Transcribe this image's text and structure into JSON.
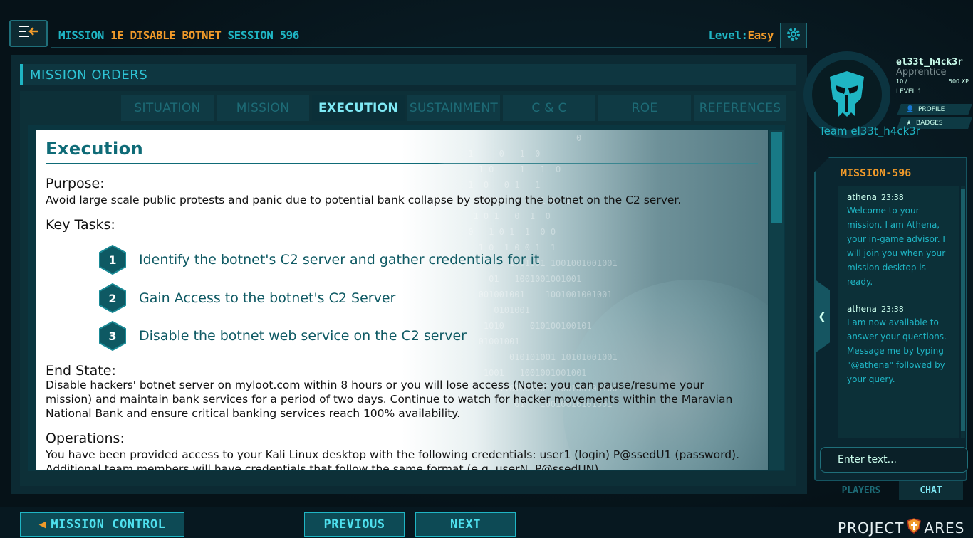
{
  "header": {
    "mission_prefix": "MISSION ",
    "mission_id": "1E DISABLE BOTNET",
    "session": " SESSION 596",
    "level_label": "Level:",
    "level_value": "Easy"
  },
  "orders": {
    "title": "MISSION ORDERS"
  },
  "tabs": [
    {
      "label": "SITUATION",
      "active": false
    },
    {
      "label": "MISSION",
      "active": false
    },
    {
      "label": "EXECUTION",
      "active": true
    },
    {
      "label": "SUSTAINMENT",
      "active": false
    },
    {
      "label": "C & C",
      "active": false
    },
    {
      "label": "ROE",
      "active": false
    },
    {
      "label": "REFERENCES",
      "active": false
    }
  ],
  "doc": {
    "title": "Execution",
    "purpose_heading": "Purpose:",
    "purpose_text": "Avoid large scale public protests and panic due to potential bank collapse by stopping the botnet on the C2 server.",
    "tasks_heading": "Key Tasks:",
    "tasks": [
      {
        "num": "1",
        "text": "Identify the botnet's C2 server and gather credentials for it"
      },
      {
        "num": "2",
        "text": "Gain Access to the botnet's C2 Server"
      },
      {
        "num": "3",
        "text": "Disable the botnet web service on the C2 server"
      }
    ],
    "endstate_heading": "End State:",
    "endstate_text": "Disable hackers' botnet server on myloot.com within 8 hours or you will lose access (Note: you can pause/resume your mission) and maintain bank services for a period of two days.  Continue to watch for hacker movements within the Maravian National Bank and ensure critical banking services reach 100% availability.",
    "operations_heading": "Operations:",
    "operations_text": "You have been provided access to your Kali Linux desktop with the following credentials: user1 (login) P@ssedU1 (password). Additional team members will have credentials that follow the same format (e.g. userN, P@ssedUN)."
  },
  "profile": {
    "username": "el33t_h4ck3r",
    "rank": "Apprentice",
    "xp_current": "10 /",
    "xp_max": "500 XP",
    "level": "LEVEL 1",
    "profile_button": "PROFILE",
    "badges_button": "BADGES",
    "team": "Team el33t_h4ck3r"
  },
  "chat": {
    "title": "MISSION-596",
    "messages": [
      {
        "author": "athena",
        "time": "23:38",
        "text": "Welcome to your mission. I am Athena, your in-game advisor. I will join you when your mission desktop is ready."
      },
      {
        "author": "athena",
        "time": "23:38",
        "text": "I am now available to answer your questions. Message me by typing \"@athena\" followed by your query."
      }
    ],
    "input_placeholder": "Enter text...",
    "tab_players": "PLAYERS",
    "tab_chat": "CHAT"
  },
  "footer": {
    "mission_control": "MISSION CONTROL",
    "previous": "PREVIOUS",
    "next": "NEXT",
    "brand_left": "PROJECT",
    "brand_right": "ARES"
  },
  "colors": {
    "accent": "#1fb5c4",
    "orange": "#f09a2a",
    "panel": "#0c2a33"
  },
  "icons": [
    "menu-icon",
    "gear-icon",
    "helmet-icon",
    "user-icon",
    "star-icon",
    "chevron-left-icon",
    "arrow-left-icon",
    "ares-shield-icon"
  ]
}
